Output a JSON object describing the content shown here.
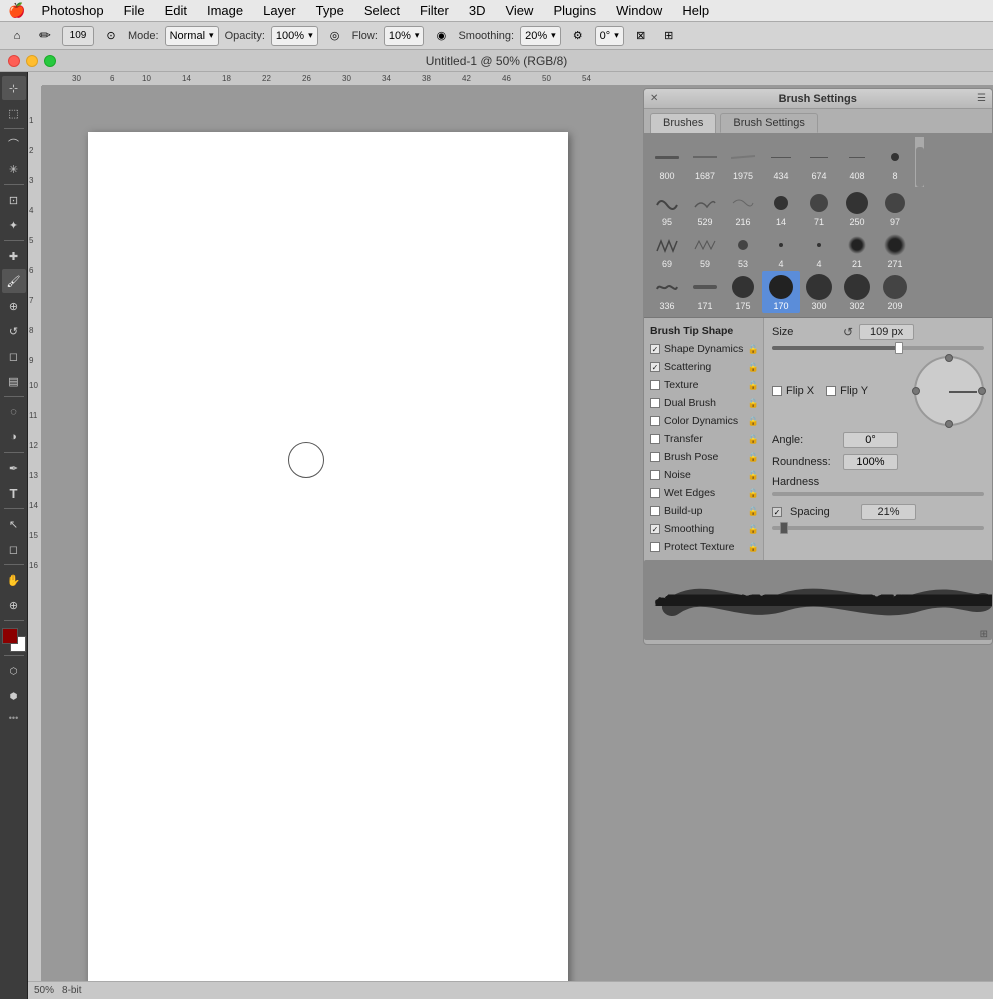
{
  "app": {
    "name": "Photoshop",
    "title": "Untitled-1 @ 50% (RGB/8)"
  },
  "menubar": {
    "apple": "🍎",
    "items": [
      "Photoshop",
      "File",
      "Edit",
      "Image",
      "Layer",
      "Type",
      "Select",
      "Filter",
      "3D",
      "View",
      "Plugins",
      "Window",
      "Help"
    ]
  },
  "optionsbar": {
    "mode_label": "Mode:",
    "mode_value": "Normal",
    "opacity_label": "Opacity:",
    "opacity_value": "100%",
    "flow_label": "Flow:",
    "flow_value": "10%",
    "smoothing_label": "Smoothing:",
    "smoothing_value": "20%",
    "angle_value": "0°"
  },
  "window": {
    "title": "Untitled-1 @ 50% (RGB/8)"
  },
  "brushpanel": {
    "title": "Brush Settings",
    "tabs": [
      "Brushes",
      "Brush Settings"
    ],
    "active_tab": "Brush Settings",
    "brush_tip_shape": "Brush Tip Shape",
    "grid_brushes": [
      {
        "num": "800",
        "shape": "line"
      },
      {
        "num": "1687",
        "shape": "line"
      },
      {
        "num": "1975",
        "shape": "line"
      },
      {
        "num": "434",
        "shape": "line"
      },
      {
        "num": "674",
        "shape": "line"
      },
      {
        "num": "408",
        "shape": "line"
      },
      {
        "num": "8",
        "shape": "dot-sm"
      },
      {
        "num": "95",
        "shape": "squiggle"
      },
      {
        "num": "529",
        "shape": "wave"
      },
      {
        "num": "216",
        "shape": "line2"
      },
      {
        "num": "14",
        "shape": "dot"
      },
      {
        "num": "71",
        "shape": "dot"
      },
      {
        "num": "250",
        "shape": "dot"
      },
      {
        "num": "97",
        "shape": "dot"
      },
      {
        "num": "69",
        "shape": "zigzag"
      },
      {
        "num": "59",
        "shape": "zigzag2"
      },
      {
        "num": "53",
        "shape": "dot-sm"
      },
      {
        "num": "4",
        "shape": "dot-sm"
      },
      {
        "num": "4",
        "shape": "dot-sm"
      },
      {
        "num": "21",
        "shape": "round"
      },
      {
        "num": "271",
        "shape": "round"
      },
      {
        "num": "336",
        "shape": "squig2"
      },
      {
        "num": "171",
        "shape": "line3"
      },
      {
        "num": "175",
        "shape": "dot-md"
      },
      {
        "num": "170",
        "shape": "dot-lg",
        "selected": true
      },
      {
        "num": "300",
        "shape": "dot-lg2"
      },
      {
        "num": "302",
        "shape": "dot-lg2"
      },
      {
        "num": "209",
        "shape": "dot-lg2"
      }
    ],
    "settings": [
      {
        "label": "Brush Tip Shape",
        "checkbox": false,
        "checked": false,
        "header": true
      },
      {
        "label": "Shape Dynamics",
        "checkbox": true,
        "checked": true
      },
      {
        "label": "Scattering",
        "checkbox": true,
        "checked": true
      },
      {
        "label": "Texture",
        "checkbox": true,
        "checked": false
      },
      {
        "label": "Dual Brush",
        "checkbox": true,
        "checked": false
      },
      {
        "label": "Color Dynamics",
        "checkbox": true,
        "checked": false
      },
      {
        "label": "Transfer",
        "checkbox": true,
        "checked": false
      },
      {
        "label": "Brush Pose",
        "checkbox": true,
        "checked": false
      },
      {
        "label": "Noise",
        "checkbox": true,
        "checked": false
      },
      {
        "label": "Wet Edges",
        "checkbox": true,
        "checked": false
      },
      {
        "label": "Build-up",
        "checkbox": true,
        "checked": false
      },
      {
        "label": "Smoothing",
        "checkbox": true,
        "checked": true
      },
      {
        "label": "Protect Texture",
        "checkbox": true,
        "checked": false
      }
    ],
    "size_label": "Size",
    "size_value": "109 px",
    "flip_x": "Flip X",
    "flip_y": "Flip Y",
    "angle_label": "Angle:",
    "angle_value": "0°",
    "roundness_label": "Roundness:",
    "roundness_value": "100%",
    "hardness_label": "Hardness",
    "spacing_label": "Spacing",
    "spacing_checked": true,
    "spacing_value": "21%"
  },
  "statusbar": {
    "zoom": "50%",
    "info": "8-bit"
  }
}
